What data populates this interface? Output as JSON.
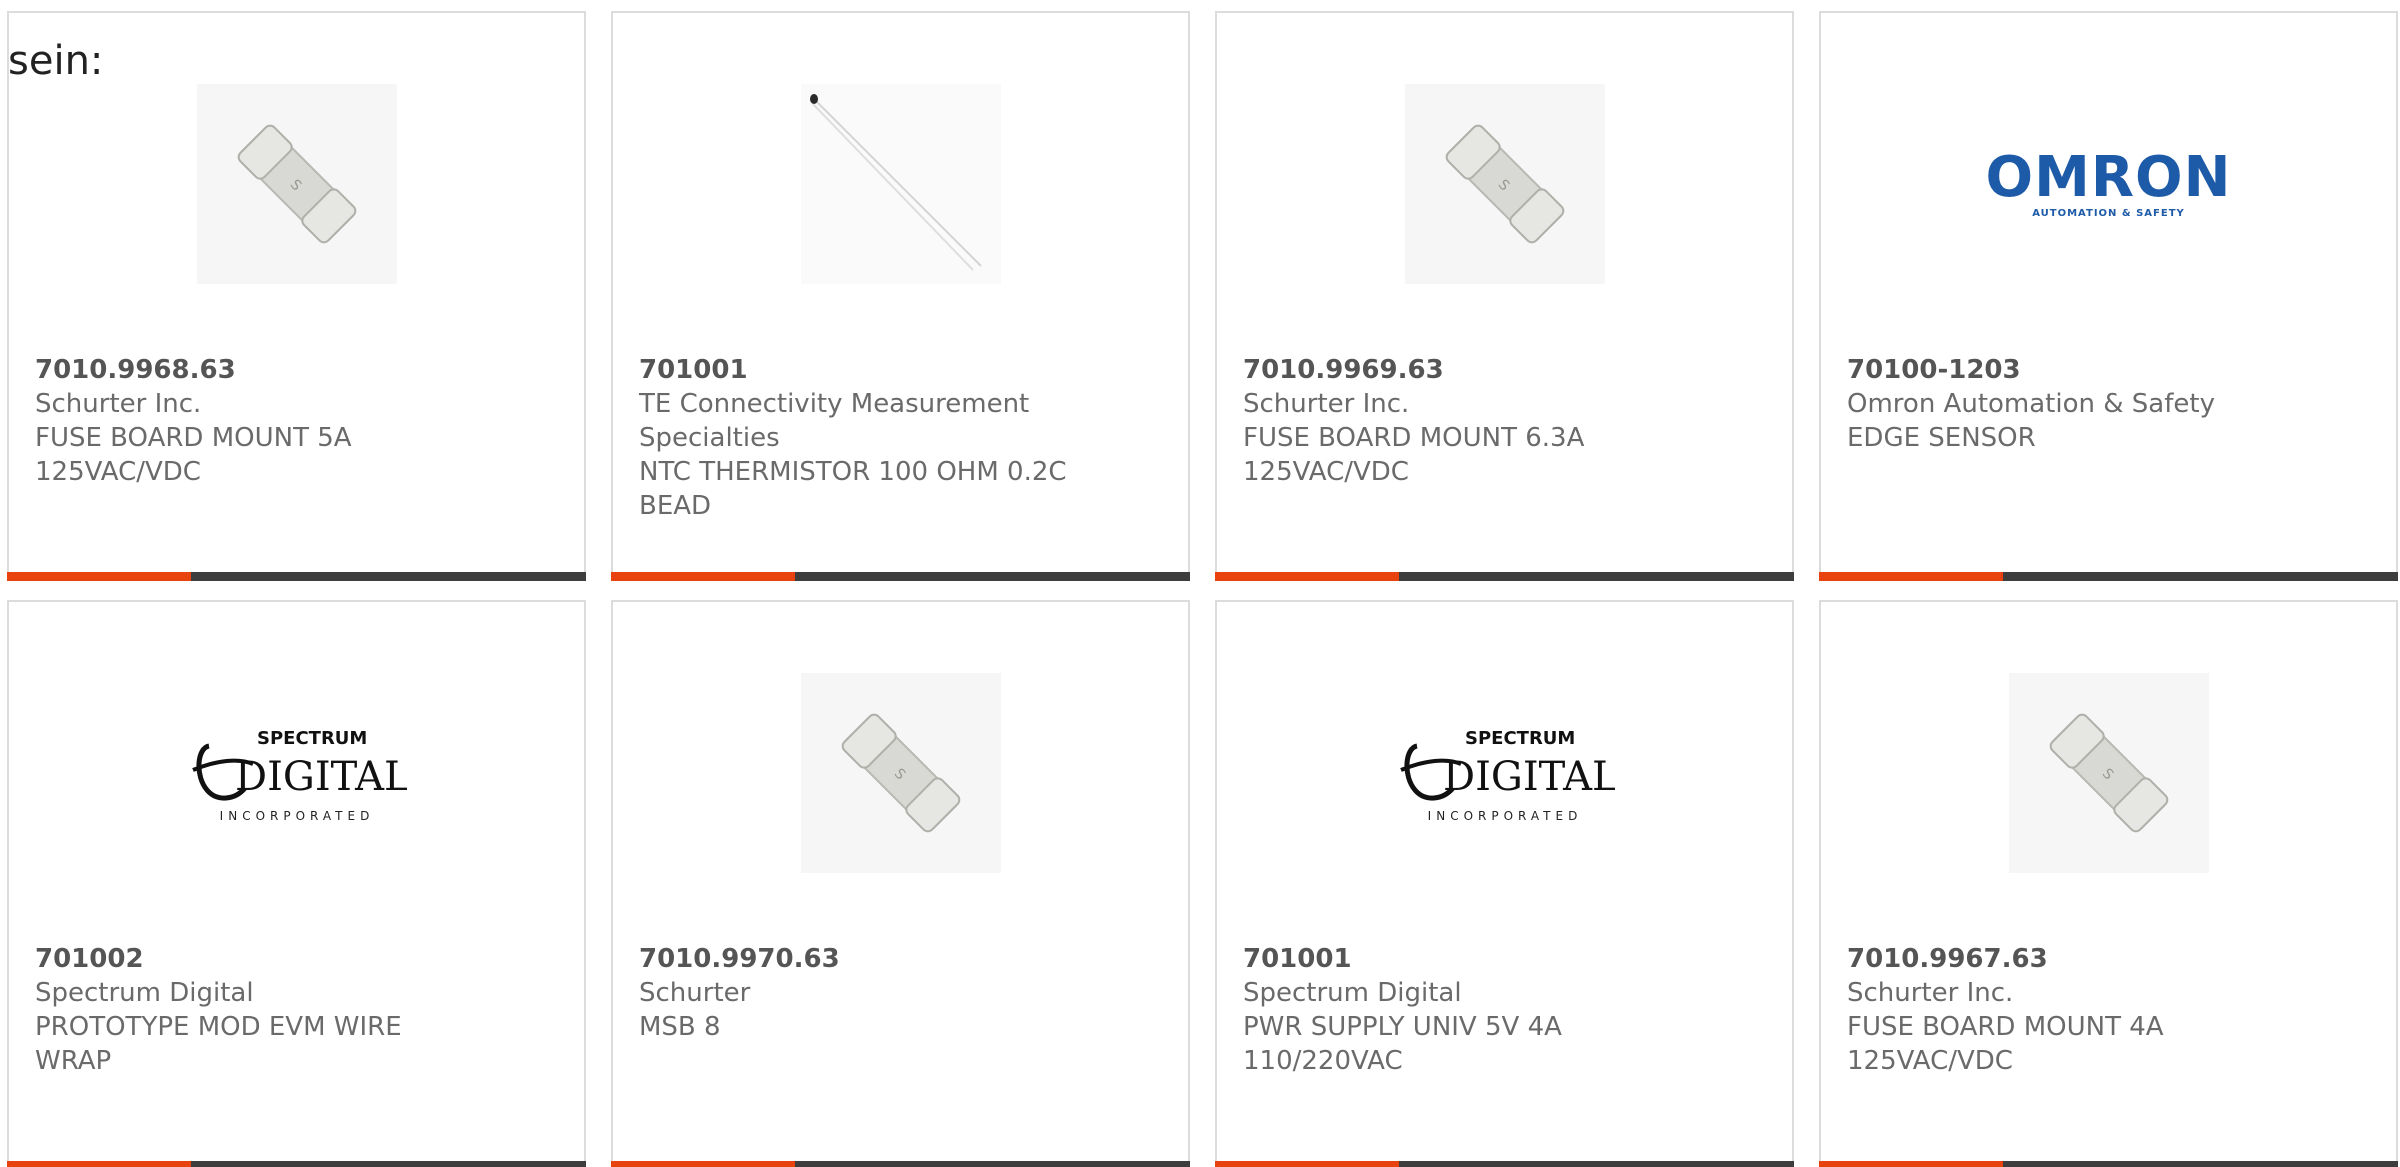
{
  "intro_text": "sein:",
  "colors": {
    "accent": "#e8430f",
    "bar": "#3d3d3d",
    "border": "#dcdcdc",
    "omron_blue": "#1d5ba8"
  },
  "products": [
    {
      "part_number": "7010.9968.63",
      "manufacturer": "Schurter Inc.",
      "description_line1": "FUSE BOARD MOUNT 5A",
      "description_line2": "125VAC/VDC",
      "image": "fuse-image"
    },
    {
      "part_number": "701001",
      "manufacturer_line1": "TE Connectivity Measurement",
      "manufacturer_line2": "Specialties",
      "description_line1": "NTC THERMISTOR 100 OHM 0.2C",
      "description_line2": "BEAD",
      "image": "thermistor-image"
    },
    {
      "part_number": "7010.9969.63",
      "manufacturer": "Schurter Inc.",
      "description_line1": "FUSE BOARD MOUNT 6.3A",
      "description_line2": "125VAC/VDC",
      "image": "fuse-image"
    },
    {
      "part_number": "70100-1203",
      "manufacturer": "Omron Automation & Safety",
      "description_line1": "EDGE SENSOR",
      "image": "omron-logo",
      "logo_text": "OMRON",
      "logo_tagline": "AUTOMATION & SAFETY"
    },
    {
      "part_number": "701002",
      "manufacturer": "Spectrum Digital",
      "description_line1": "PROTOTYPE MOD EVM WIRE",
      "description_line2": "WRAP",
      "image": "spectrum-digital-logo",
      "logo_text_top": "SPECTRUM",
      "logo_text_main": "DIGITAL",
      "logo_text_bottom": "INCORPORATED"
    },
    {
      "part_number": "7010.9970.63",
      "manufacturer": "Schurter",
      "description_line1": "MSB 8",
      "image": "fuse-image"
    },
    {
      "part_number": "701001",
      "manufacturer": "Spectrum Digital",
      "description_line1": "PWR SUPPLY UNIV 5V 4A",
      "description_line2": "110/220VAC",
      "image": "spectrum-digital-logo",
      "logo_text_top": "SPECTRUM",
      "logo_text_main": "DIGITAL",
      "logo_text_bottom": "INCORPORATED"
    },
    {
      "part_number": "7010.9967.63",
      "manufacturer": "Schurter Inc.",
      "description_line1": "FUSE BOARD MOUNT 4A",
      "description_line2": "125VAC/VDC",
      "image": "fuse-image"
    }
  ]
}
